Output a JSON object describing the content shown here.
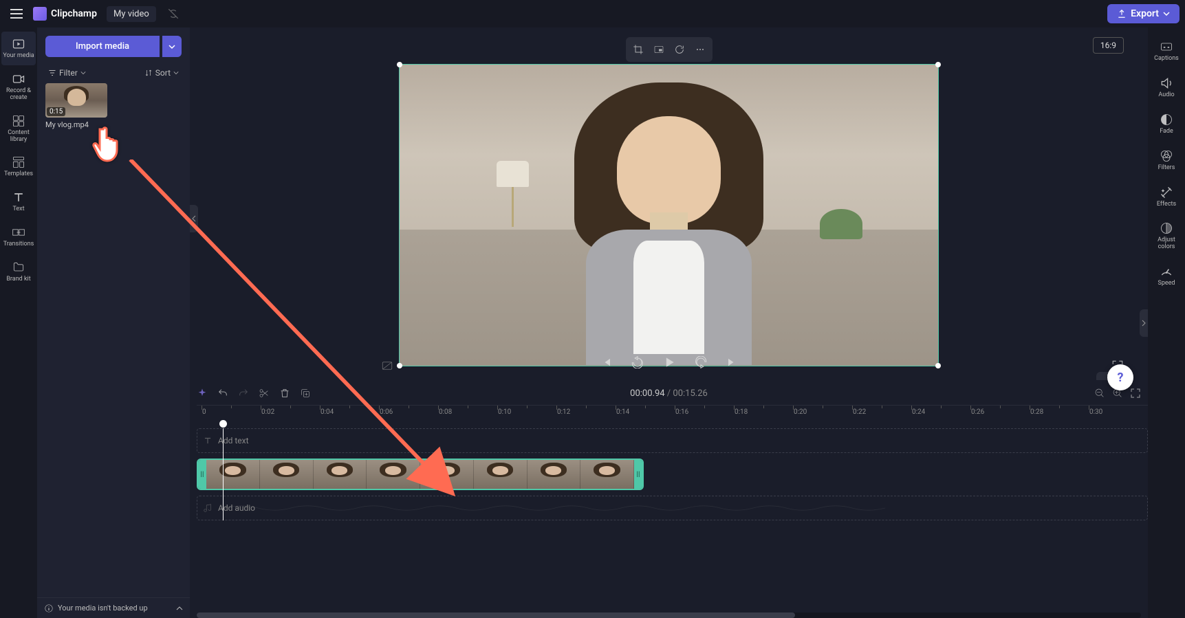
{
  "app": {
    "name": "Clipchamp",
    "video_title": "My video"
  },
  "export": {
    "label": "Export"
  },
  "left_rail": [
    {
      "label": "Your media"
    },
    {
      "label": "Record & create"
    },
    {
      "label": "Content library"
    },
    {
      "label": "Templates"
    },
    {
      "label": "Text"
    },
    {
      "label": "Transitions"
    },
    {
      "label": "Brand kit"
    }
  ],
  "import": {
    "label": "Import media"
  },
  "filter": {
    "label": "Filter"
  },
  "sort": {
    "label": "Sort"
  },
  "media": {
    "duration": "0:15",
    "name": "My vlog.mp4"
  },
  "aspect": "16:9",
  "time": {
    "current": "00:00.94",
    "sep": " / ",
    "total": "00:15.26"
  },
  "ruler_ticks": [
    "0",
    "0:02",
    "0:04",
    "0:06",
    "0:08",
    "0:10",
    "0:12",
    "0:14",
    "0:16",
    "0:18",
    "0:20",
    "0:22",
    "0:24",
    "0:26",
    "0:28",
    "0:30"
  ],
  "tracks": {
    "text": "Add text",
    "audio": "Add audio"
  },
  "right_rail": [
    {
      "label": "Captions"
    },
    {
      "label": "Audio"
    },
    {
      "label": "Fade"
    },
    {
      "label": "Filters"
    },
    {
      "label": "Effects"
    },
    {
      "label": "Adjust colors"
    },
    {
      "label": "Speed"
    }
  ],
  "backup": {
    "text": "Your media isn't backed up"
  },
  "help": {
    "label": "?"
  }
}
